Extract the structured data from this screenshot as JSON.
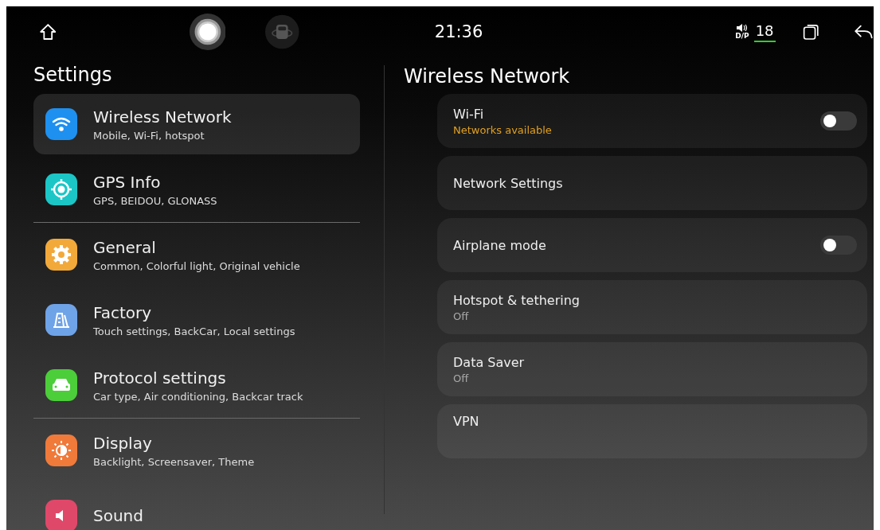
{
  "status_bar": {
    "time": "21:36",
    "volume": "18",
    "audio_mode": "D/P"
  },
  "sidebar": {
    "title": "Settings",
    "items": [
      {
        "kind": "wifi",
        "color": "#1e90f0",
        "title": "Wireless Network",
        "subtitle": "Mobile, Wi-Fi, hotspot",
        "selected": true,
        "divider_after": false
      },
      {
        "kind": "gps",
        "color": "#1cc6c6",
        "title": "GPS Info",
        "subtitle": "GPS, BEIDOU, GLONASS",
        "selected": false,
        "divider_after": true
      },
      {
        "kind": "gear",
        "color": "#f2a93a",
        "title": "General",
        "subtitle": "Common, Colorful light, Original vehicle",
        "selected": false,
        "divider_after": false
      },
      {
        "kind": "factory",
        "color": "#6fa3e8",
        "title": "Factory",
        "subtitle": "Touch settings, BackCar, Local settings",
        "selected": false,
        "divider_after": false
      },
      {
        "kind": "car",
        "color": "#4ccd3a",
        "title": "Protocol settings",
        "subtitle": "Car type, Air conditioning, Backcar track",
        "selected": false,
        "divider_after": true
      },
      {
        "kind": "display",
        "color": "#f07a3a",
        "title": "Display",
        "subtitle": "Backlight, Screensaver, Theme",
        "selected": false,
        "divider_after": false
      },
      {
        "kind": "sound",
        "color": "#e0486a",
        "title": "Sound",
        "selected": false,
        "divider_after": false
      }
    ]
  },
  "panel": {
    "title": "Wireless Network",
    "rows": [
      {
        "kind": "toggle",
        "title": "Wi-Fi",
        "subtitle": "Networks available",
        "subtitle_accent": true,
        "on": false
      },
      {
        "kind": "plain",
        "title": "Network Settings"
      },
      {
        "kind": "toggle",
        "title": "Airplane mode",
        "on": false
      },
      {
        "kind": "plain",
        "title": "Hotspot & tethering",
        "subtitle": "Off",
        "subtitle_accent": false
      },
      {
        "kind": "plain",
        "title": "Data Saver",
        "subtitle": "Off",
        "subtitle_accent": false
      },
      {
        "kind": "plain",
        "title": "VPN"
      }
    ]
  }
}
